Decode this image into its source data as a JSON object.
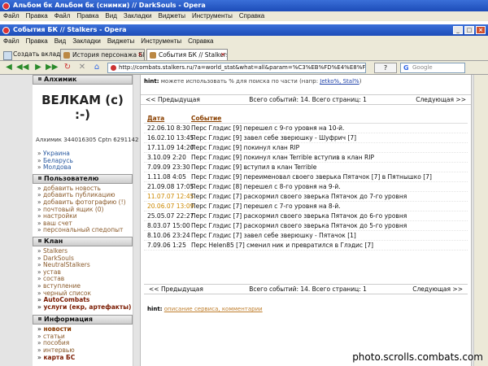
{
  "windows": {
    "back": {
      "title": "Альбом бк Альбом бк (снимки) // DarkSouls - Opera",
      "menu": [
        "Файл",
        "Правка",
        "Файл",
        "Правка",
        "Вид",
        "Закладки",
        "Виджеты",
        "Инструменты",
        "Справка"
      ]
    },
    "front": {
      "title": "События БК // Stalkers - Opera",
      "menu": [
        "Файл",
        "Правка",
        "Вид",
        "Закладки",
        "Виджеты",
        "Инструменты",
        "Справка"
      ]
    }
  },
  "tabs": {
    "new_tab": "Создать вкладку",
    "items": [
      {
        "label": "История персонажа БК ...",
        "active": false
      },
      {
        "label": "События БК // Stalkers",
        "active": true
      }
    ]
  },
  "address": {
    "url": "http://combats.stalkers.ru/?a=world_stat&what=all&param=%C3%EB%FD%E4%E8%F1&no_pets=",
    "search_placeholder": "Google",
    "help": "?"
  },
  "sidebar": {
    "header1": "Алхимик",
    "logo": "ВЕЛКАМ (с) :-)",
    "users": "Алхимик 344016305 Cptn 6291142",
    "countries": [
      "Украина",
      "Беларусь",
      "Молдова"
    ],
    "user_header": "Пользователю",
    "user_links": [
      "добавить новость",
      "добавить публикацию",
      "добавить фотографию (!)",
      "почтовый ящик (0)",
      "настройки",
      "ваш счет",
      "персональный спедопыт"
    ],
    "clan_header": "Клан",
    "clan_links": [
      "Stalkers",
      "DarkSouls",
      "NeutralStalkers",
      "устав",
      "состав",
      "вступление",
      "черный список"
    ],
    "clan_bold": [
      "AutoCombats",
      "услуги (екр, артефакты)"
    ],
    "info_header": "Информация",
    "info_links": [
      "новости",
      "статьи",
      "пособия",
      "интервью"
    ],
    "info_bold": "карта БС"
  },
  "main": {
    "hint_label": "hint:",
    "hint_text": "можете использовать % для поиска по части (напр:",
    "hint_examples": "Jetko%, Stal%",
    "hint_close": ")",
    "prev": "<< Предыдущая",
    "next": "Следующая >>",
    "summary": "Всего событий: 14. Всего страниц: 1",
    "col_date": "Дата",
    "col_event": "Событие",
    "events": [
      {
        "date": "22.06.10 8:30",
        "text": "Перс Глэдис [9] перешел с 9-го уровня на 10-й.",
        "old": false
      },
      {
        "date": "16.02.10 13:45",
        "text": "Перс Глэдис [9] завел себе зверюшку - Шуфрич [7]",
        "old": false
      },
      {
        "date": "17.11.09 14:20",
        "text": "Перс Глэдис [9] покинул клан RIP",
        "old": false
      },
      {
        "date": "3.10.09 2:20",
        "text": "Перс Глэдис [9] покинул клан Terrible вступив в клан RIP",
        "old": false
      },
      {
        "date": "7.09.09 23:30",
        "text": "Перс Глэдис [9] вступил в клан Terrible",
        "old": false
      },
      {
        "date": "1.11.08 4:05",
        "text": "Перс Глэдис [9] переименовал своего зверька Пятачок [7] в Пятнышко [7]",
        "old": false
      },
      {
        "date": "21.09.08 17:05",
        "text": "Перс Глэдис [8] перешел с 8-го уровня на 9-й.",
        "old": false
      },
      {
        "date": "11.07.07 12:45",
        "text": "Перс Глэдис [7] раскормил своего зверька Пятачок до 7-го уровня",
        "old": true
      },
      {
        "date": "20.06.07 13:09",
        "text": "Перс Глэдис [7] перешел с 7-го уровня на 8-й.",
        "old": true
      },
      {
        "date": "25.05.07 22:27",
        "text": "Перс Глэдис [7] раскормил своего зверька Пятачок до 6-го уровня",
        "old": false
      },
      {
        "date": "8.03.07 15:00",
        "text": "Перс Глэдис [7] раскормил своего зверька Пятачок до 5-го уровня",
        "old": false
      },
      {
        "date": "8.10.06 23:24",
        "text": "Перс Глэдис [7] завел себе зверюшку - Пятачок [1]",
        "old": false
      },
      {
        "date": "7.09.06 1:25",
        "text": "Перс Helen85 [7] сменил ник и превратился в Глэдис [7]",
        "old": false
      }
    ],
    "footer_hint": "hint:",
    "footer_link": "описание сервиса, комментарии"
  },
  "watermark": "photo.scrolls.combats.com"
}
